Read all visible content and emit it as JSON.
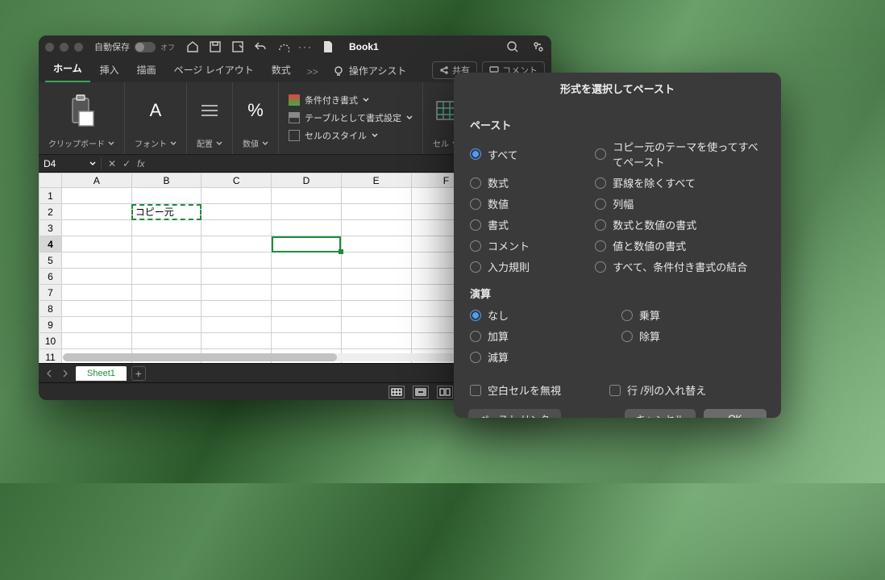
{
  "titlebar": {
    "autosave_label": "自動保存",
    "autosave_state": "オフ",
    "document_title": "Book1"
  },
  "tabs": {
    "items": [
      "ホーム",
      "挿入",
      "描画",
      "ページ レイアウト",
      "数式"
    ],
    "active_index": 0,
    "tell_me": "操作アシスト",
    "share": "共有",
    "comment": "コメント"
  },
  "ribbon": {
    "clipboard": "クリップボード",
    "font": "フォント",
    "alignment": "配置",
    "number": "数値",
    "fmt_conditional": "条件付き書式",
    "fmt_table": "テーブルとして書式設定",
    "fmt_cellstyle": "セルのスタイル",
    "cells": "セル"
  },
  "namebox": {
    "ref": "D4",
    "fx": "fx"
  },
  "grid": {
    "columns": [
      "A",
      "B",
      "C",
      "D",
      "E",
      "F",
      ""
    ],
    "rows": [
      1,
      2,
      3,
      4,
      5,
      6,
      7,
      8,
      9,
      10,
      11
    ],
    "copy_cell": {
      "row": 2,
      "col": "B",
      "value": "コピー元"
    },
    "selected": {
      "row": 4,
      "col": "D"
    }
  },
  "sheet_tabs": {
    "active": "Sheet1"
  },
  "dialog": {
    "title": "形式を選択してペースト",
    "paste_header": "ペースト",
    "paste_left": [
      "すべて",
      "数式",
      "数値",
      "書式",
      "コメント",
      "入力規則"
    ],
    "paste_right": [
      "コピー元のテーマを使ってすべてペースト",
      "罫線を除くすべて",
      "列幅",
      "数式と数値の書式",
      "値と数値の書式",
      "すべて、条件付き書式の結合"
    ],
    "operation_header": "演算",
    "op_left": [
      "なし",
      "加算",
      "減算"
    ],
    "op_right": [
      "乗算",
      "除算"
    ],
    "skip_blanks": "空白セルを無視",
    "transpose": "行 /列の入れ替え",
    "paste_link": "ペースト リンク",
    "cancel": "キャンセル",
    "ok": "OK"
  }
}
